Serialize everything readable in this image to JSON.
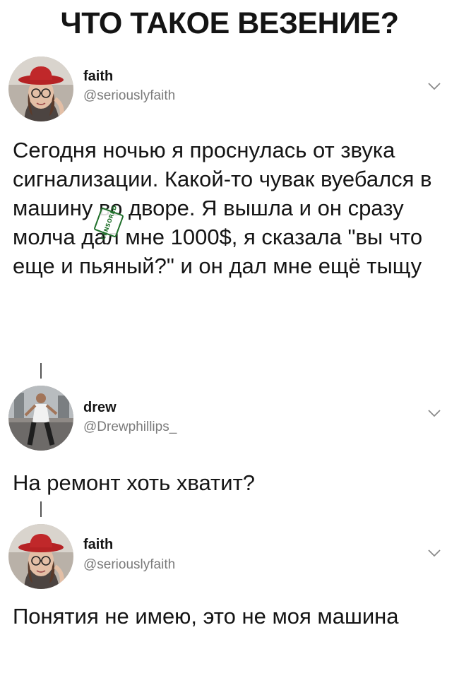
{
  "headline": "ЧТО ТАКОЕ ВЕЗЕНИЕ?",
  "tweets": [
    {
      "author_name": "faith",
      "author_handle": "@seriouslyfaith",
      "avatar": "avatar-girl-red-hat-icon",
      "text": "Сегодня ночью я проснулась от звука сигнализации. Какой-то чувак вуебался в машину во дворе. Я вышла и он сразу молча дал мне 1000$, я сказала \"вы что еще и пьяный?\" и он дал мне ещё тыщу",
      "censor_stamp": "CENSORED"
    },
    {
      "author_name": "drew",
      "author_handle": "@Drewphillips_",
      "avatar": "avatar-boy-street-icon",
      "text": "На ремонт хоть хватит?"
    },
    {
      "author_name": "faith",
      "author_handle": "@seriouslyfaith",
      "avatar": "avatar-girl-red-hat-icon",
      "text": "Понятия не имею, это не моя машина"
    }
  ],
  "icons": {
    "more": "chevron-down-icon"
  },
  "colors": {
    "text": "#141414",
    "handle": "#7b7b7b",
    "hat_red": "#c0282a",
    "stamp_green": "#1f6f2a"
  }
}
